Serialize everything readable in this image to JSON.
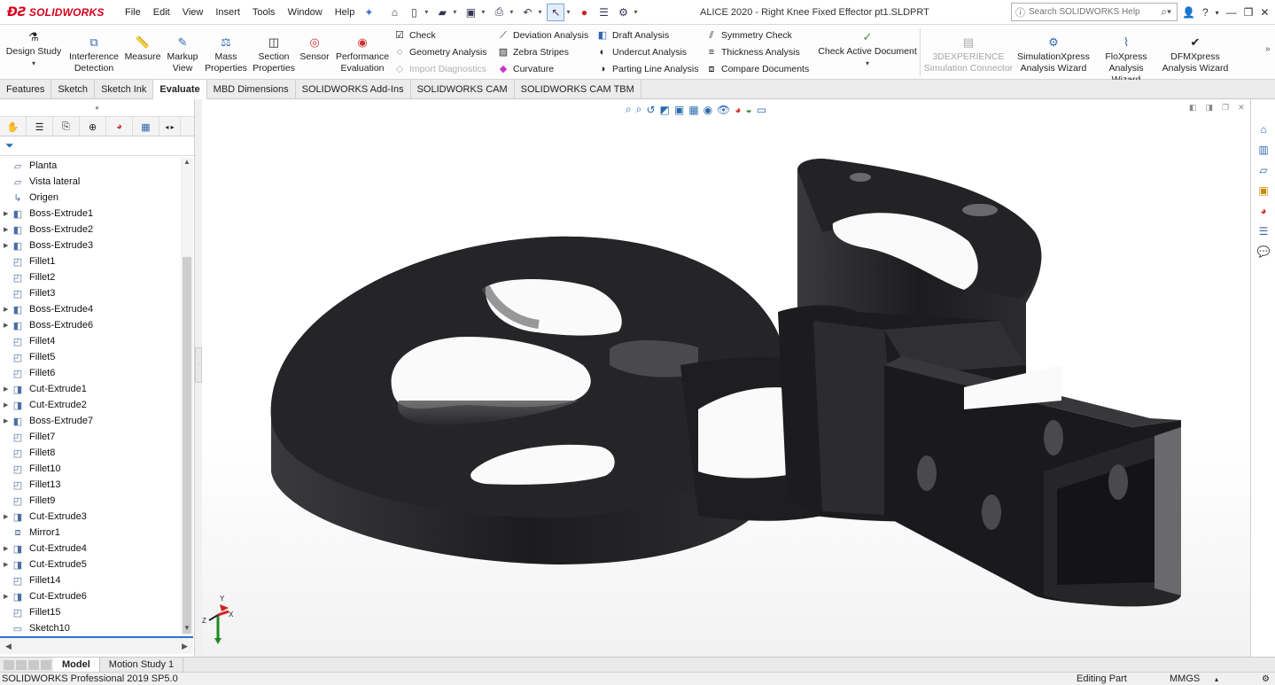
{
  "app": {
    "brand": "SOLIDWORKS",
    "doc_title": "ALICE 2020 - Right Knee Fixed Effector pt1.SLDPRT"
  },
  "menu": [
    "File",
    "Edit",
    "View",
    "Insert",
    "Tools",
    "Window",
    "Help"
  ],
  "search": {
    "placeholder": "Search SOLIDWORKS Help"
  },
  "ribbon": {
    "design_study": "Design Study",
    "interference_1": "Interference",
    "interference_2": "Detection",
    "measure": "Measure",
    "markup_1": "Markup",
    "markup_2": "View",
    "mass_1": "Mass",
    "mass_2": "Properties",
    "section_1": "Section",
    "section_2": "Properties",
    "sensor": "Sensor",
    "performance_1": "Performance",
    "performance_2": "Evaluation",
    "check": "Check",
    "geometry_analysis": "Geometry Analysis",
    "import_diagnostics": "Import Diagnostics",
    "deviation_analysis": "Deviation Analysis",
    "zebra_stripes": "Zebra Stripes",
    "curvature": "Curvature",
    "draft_analysis": "Draft Analysis",
    "undercut_analysis": "Undercut Analysis",
    "parting_line_analysis": "Parting Line Analysis",
    "symmetry_check": "Symmetry Check",
    "thickness_analysis": "Thickness Analysis",
    "compare_documents": "Compare Documents",
    "check_active_document": "Check Active Document",
    "threedx_1": "3DEXPERIENCE",
    "threedx_2": "Simulation Connector",
    "simxpress_1": "SimulationXpress",
    "simxpress_2": "Analysis Wizard",
    "floxpress_1": "FloXpress",
    "floxpress_2": "Analysis Wizard",
    "dfmxpress_1": "DFMXpress",
    "dfmxpress_2": "Analysis Wizard"
  },
  "tabs": [
    "Features",
    "Sketch",
    "Sketch Ink",
    "Evaluate",
    "MBD Dimensions",
    "SOLIDWORKS Add-Ins",
    "SOLIDWORKS CAM",
    "SOLIDWORKS CAM TBM"
  ],
  "active_tab": "Evaluate",
  "tree": [
    {
      "label": "Planta",
      "icon": "plane-icon",
      "expandable": false
    },
    {
      "label": "Vista lateral",
      "icon": "plane-icon",
      "expandable": false
    },
    {
      "label": "Origen",
      "icon": "origin-icon",
      "expandable": false
    },
    {
      "label": "Boss-Extrude1",
      "icon": "boss-extrude-icon",
      "expandable": true
    },
    {
      "label": "Boss-Extrude2",
      "icon": "boss-extrude-icon",
      "expandable": true
    },
    {
      "label": "Boss-Extrude3",
      "icon": "boss-extrude-icon",
      "expandable": true
    },
    {
      "label": "Fillet1",
      "icon": "fillet-icon",
      "expandable": false
    },
    {
      "label": "Fillet2",
      "icon": "fillet-icon",
      "expandable": false
    },
    {
      "label": "Fillet3",
      "icon": "fillet-icon",
      "expandable": false
    },
    {
      "label": "Boss-Extrude4",
      "icon": "boss-extrude-icon",
      "expandable": true
    },
    {
      "label": "Boss-Extrude6",
      "icon": "boss-extrude-icon",
      "expandable": true
    },
    {
      "label": "Fillet4",
      "icon": "fillet-icon",
      "expandable": false
    },
    {
      "label": "Fillet5",
      "icon": "fillet-icon",
      "expandable": false
    },
    {
      "label": "Fillet6",
      "icon": "fillet-icon",
      "expandable": false
    },
    {
      "label": "Cut-Extrude1",
      "icon": "cut-extrude-icon",
      "expandable": true
    },
    {
      "label": "Cut-Extrude2",
      "icon": "cut-extrude-icon",
      "expandable": true
    },
    {
      "label": "Boss-Extrude7",
      "icon": "boss-extrude-icon",
      "expandable": true
    },
    {
      "label": "Fillet7",
      "icon": "fillet-icon",
      "expandable": false
    },
    {
      "label": "Fillet8",
      "icon": "fillet-icon",
      "expandable": false
    },
    {
      "label": "Fillet10",
      "icon": "fillet-icon",
      "expandable": false
    },
    {
      "label": "Fillet13",
      "icon": "fillet-icon",
      "expandable": false
    },
    {
      "label": "Fillet9",
      "icon": "fillet-icon",
      "expandable": false
    },
    {
      "label": "Cut-Extrude3",
      "icon": "cut-extrude-icon",
      "expandable": true
    },
    {
      "label": "Mirror1",
      "icon": "mirror-icon",
      "expandable": false
    },
    {
      "label": "Cut-Extrude4",
      "icon": "cut-extrude-icon",
      "expandable": true
    },
    {
      "label": "Cut-Extrude5",
      "icon": "cut-extrude-icon",
      "expandable": true
    },
    {
      "label": "Fillet14",
      "icon": "fillet-icon",
      "expandable": false
    },
    {
      "label": "Cut-Extrude6",
      "icon": "cut-extrude-icon",
      "expandable": true
    },
    {
      "label": "Fillet15",
      "icon": "fillet-icon",
      "expandable": false
    },
    {
      "label": "Sketch10",
      "icon": "sketch-icon",
      "expandable": false
    }
  ],
  "bottom_tabs": [
    "Model",
    "Motion Study 1"
  ],
  "status": {
    "product": "SOLIDWORKS Professional 2019 SP5.0",
    "mode": "Editing Part",
    "units": "MMGS"
  },
  "colors": {
    "accent": "#2e75c8",
    "brand": "#d6001c",
    "part": "#262628"
  }
}
